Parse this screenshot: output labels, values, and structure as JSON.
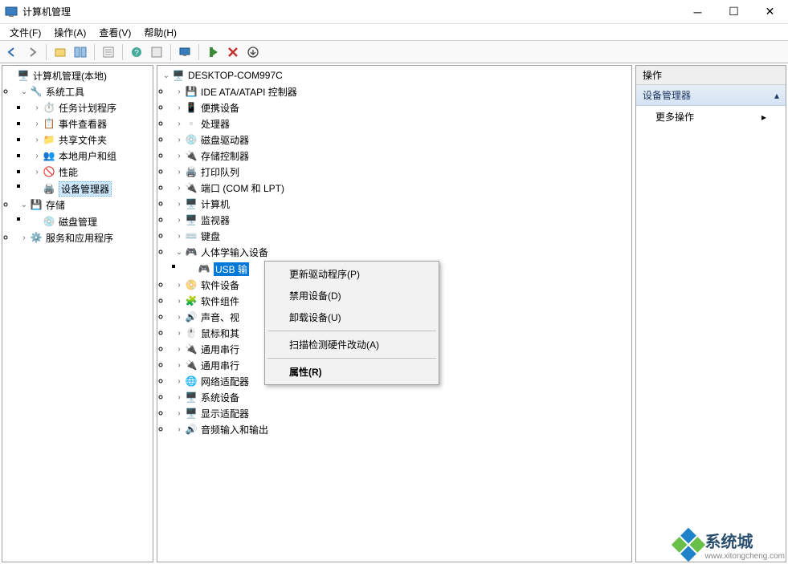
{
  "window": {
    "title": "计算机管理",
    "min": "─",
    "max": "☐",
    "close": "✕"
  },
  "menu": {
    "file": "文件(F)",
    "action": "操作(A)",
    "view": "查看(V)",
    "help": "帮助(H)"
  },
  "left_tree": {
    "root": "计算机管理(本地)",
    "system_tools": "系统工具",
    "task_scheduler": "任务计划程序",
    "event_viewer": "事件查看器",
    "shared_folders": "共享文件夹",
    "local_users": "本地用户和组",
    "performance": "性能",
    "device_manager": "设备管理器",
    "storage": "存储",
    "disk_management": "磁盘管理",
    "services": "服务和应用程序"
  },
  "devices": {
    "root": "DESKTOP-COM997C",
    "ide": "IDE ATA/ATAPI 控制器",
    "portable": "便携设备",
    "processors": "处理器",
    "disk_drives": "磁盘驱动器",
    "storage_ctrl": "存储控制器",
    "print_queues": "打印队列",
    "ports": "端口 (COM 和 LPT)",
    "computer": "计算机",
    "monitors": "监视器",
    "keyboards": "键盘",
    "hid": "人体学输入设备",
    "usb_input": "USB 输",
    "software_dev": "软件设备",
    "software_comp": "软件组件",
    "sound": "声音、视",
    "mouse": "鼠标和其",
    "usb_bus1": "通用串行",
    "usb_bus2": "通用串行",
    "network": "网络适配器",
    "system_dev": "系统设备",
    "display": "显示适配器",
    "audio_io": "音频输入和输出"
  },
  "context_menu": {
    "update": "更新驱动程序(P)",
    "disable": "禁用设备(D)",
    "uninstall": "卸载设备(U)",
    "scan": "扫描检测硬件改动(A)",
    "properties": "属性(R)"
  },
  "right": {
    "header": "操作",
    "group": "设备管理器",
    "more": "更多操作"
  },
  "watermark": {
    "brand": "系统城",
    "url": "www.xitongcheng.com"
  }
}
